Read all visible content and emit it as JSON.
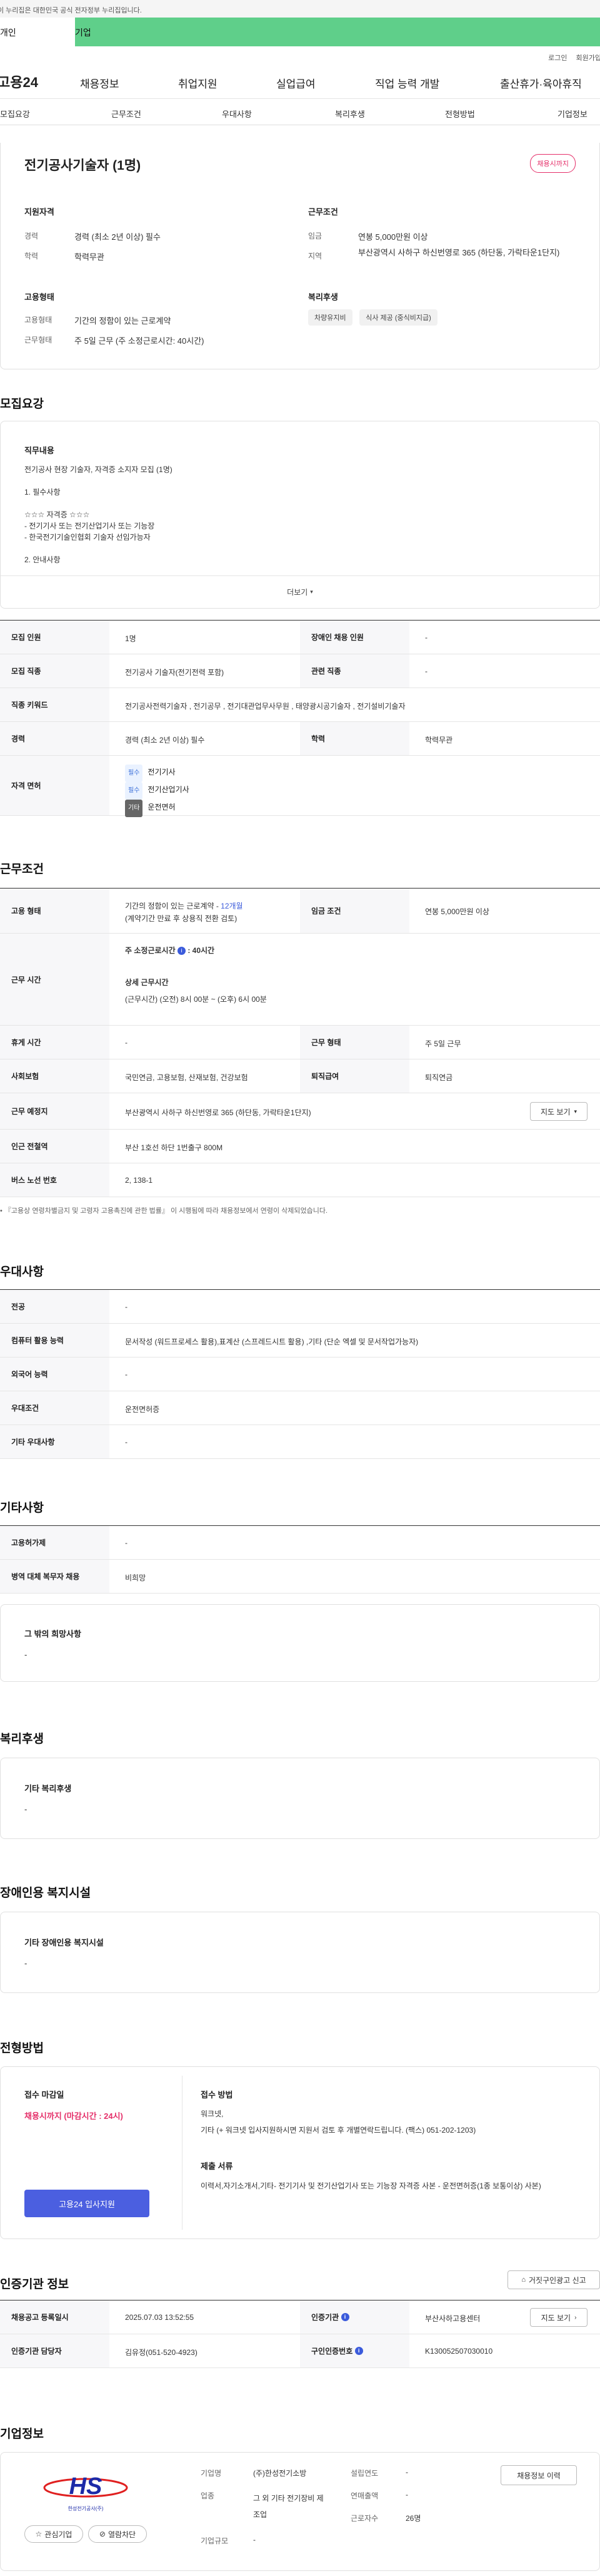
{
  "gov_banner": "이 누리집은 대한민국 공식 전자정부 누리집입니다.",
  "tabs": {
    "personal": "개인",
    "business": "기업"
  },
  "util": {
    "login": "로그인",
    "join": "회원가입"
  },
  "gnb": {
    "logo": "고용24",
    "items": [
      "채용정보",
      "취업지원",
      "실업급여",
      "직업 능력 개발",
      "출산휴가·육아휴직"
    ]
  },
  "subnav": [
    "모집요강",
    "근무조건",
    "우대사항",
    "복리후생",
    "전형방법",
    "기업정보"
  ],
  "summary": {
    "title": "전기공사기술자 (1명)",
    "badge": "채용시까지",
    "qual_title": "지원자격",
    "qual": [
      {
        "k": "경력",
        "v": "경력 (최소 2년 이상) 필수"
      },
      {
        "k": "학력",
        "v": "학력무관"
      }
    ],
    "cond_title": "근무조건",
    "cond": [
      {
        "k": "임금",
        "v": "연봉 5,000만원 이상"
      },
      {
        "k": "지역",
        "v": "부산광역시 사하구 하신번영로 365 (하단동, 가락타운1단지)"
      }
    ],
    "emp_title": "고용형태",
    "emp": [
      {
        "k": "고용형태",
        "v": "기간의 정함이 있는 근로계약"
      },
      {
        "k": "근무형태",
        "v": "주 5일 근무 (주 소정근로시간: 40시간)"
      }
    ],
    "welfare_title": "복리후생",
    "welfare_chips": [
      "차량유지비",
      "식사 제공 (중식비지급)"
    ]
  },
  "recruit": {
    "title": "모집요강",
    "duty_title": "직무내용",
    "duty_lines": [
      "전기공사 현장 기술자, 자격증 소지자 모집 (1명)",
      "",
      "1. 필수사항",
      "",
      "☆☆☆ 자격증 ☆☆☆",
      "- 전기기사 또는 전기산업기사 또는 기능장",
      "- 한국전기기술인협회 기술자 선임가능자",
      "",
      "2. 안내사항"
    ],
    "more": "더보기",
    "rows": [
      {
        "k1": "모집 인원",
        "v1": "1명",
        "k2": "장애인 채용 인원",
        "v2": "-"
      },
      {
        "k1": "모집 직종",
        "v1": "전기공사 기술자(전기전력 포함)",
        "k2": "관련 직종",
        "v2": "-"
      },
      {
        "k1": "직종 키워드",
        "v1": "전기공사전력기술자 , 전기공무 , 전기대관업무사무원 , 태양광시공기술자 , 전기설비기술자"
      },
      {
        "k1": "경력",
        "v1": "경력 (최소 2년 이상) 필수",
        "k2": "학력",
        "v2": "학력무관"
      }
    ],
    "license_label": "자격 면허",
    "licenses": [
      {
        "tag": "필수",
        "name": "전기기사"
      },
      {
        "tag": "필수",
        "name": "전기산업기사"
      },
      {
        "tag": "기타",
        "name": "운전면허"
      }
    ]
  },
  "work": {
    "title": "근무조건",
    "emp_type_label": "고용 형태",
    "emp_type": "기간의 정함이 있는 근로계약 - ",
    "emp_months": "12개월",
    "emp_note": "(계약기간 만료 후 상용직 전환 검토)",
    "wage_label": "임금 조건",
    "wage": "연봉 5,000만원 이상",
    "hours_label": "근무 시간",
    "hours_main": "주 소정근로시간",
    "hours_value": ": 40시간",
    "hours_detail_title": "상세 근무시간",
    "hours_detail": "(근무시간) (오전) 8시 00분 ~ (오후) 6시 00분",
    "rest_label": "휴게 시간",
    "rest": "-",
    "form_label": "근무 형태",
    "form": "주 5일 근무",
    "insurance_label": "사회보험",
    "insurance": "국민연금, 고용보험, 산재보험, 건강보험",
    "retire_label": "퇴직급여",
    "retire": "퇴직연금",
    "place_label": "근무 예정지",
    "place": "부산광역시 사하구 하신번영로 365 (하단동, 가락타운1단지)",
    "map_btn": "지도 보기",
    "subway_label": "인근 전철역",
    "subway": "부산 1호선 하단 1번출구 800M",
    "bus_label": "버스 노선 번호",
    "bus": "2, 138-1",
    "notice": "『고용상 연령차별금지 및 고령자 고용촉진에 관한 법률』 이 시행됨에 따라 채용정보에서 연령이 삭제되었습니다."
  },
  "prefer": {
    "title": "우대사항",
    "rows": [
      {
        "k": "전공",
        "v": "-"
      },
      {
        "k": "컴퓨터 활용 능력",
        "v": "문서작성 (워드프로세스 활용),표계산 (스프레드시트 활용) ,기타 (단순 엑셀 및 문서작업가능자)"
      },
      {
        "k": "외국어 능력",
        "v": "-"
      },
      {
        "k": "우대조건",
        "v": "운전면허증"
      },
      {
        "k": "기타 우대사항",
        "v": "-"
      }
    ]
  },
  "etc": {
    "title": "기타사항",
    "rows": [
      {
        "k": "고용허가제",
        "v": "-"
      },
      {
        "k": "병역 대체 복무자 채용",
        "v": "비희망"
      }
    ],
    "wish_title": "그 밖의 희망사항",
    "wish": "-"
  },
  "benefit": {
    "title": "복리후생",
    "box_title": "기타 복리후생",
    "box_val": "-"
  },
  "disabled": {
    "title": "장애인용 복지시설",
    "box_title": "기타 장애인용 복지시설",
    "box_val": "-"
  },
  "process": {
    "title": "전형방법",
    "deadline_title": "접수 마감일",
    "deadline": "채용시까지 (마감시간 : 24시)",
    "apply_btn": "고용24 입사지원",
    "method_title": "접수 방법",
    "method_lines": [
      "워크넷,",
      "기타 (+ 워크넷 입사지원하시면 지원서 검토 후 개별연락드립니다.  (팩스) 051-202-1203)"
    ],
    "docs_title": "제출 서류",
    "docs": "이력서,자기소개서,기타- 전기기사 및 전기산업기사 또는 기능장 자격증 사본 - 운전면허증(1종 보통이상) 사본)"
  },
  "agency": {
    "title": "인증기관 정보",
    "report_btn": "거짓구인광고 신고",
    "rows": [
      {
        "k1": "채용공고 등록일시",
        "v1": "2025.07.03 13:52:55",
        "k2": "인증기관",
        "v2": "부산사하고용센터"
      },
      {
        "k1": "인증기관 담당자",
        "v1": "김유정(051-520-4923)",
        "k2": "구인인증번호",
        "v2": "K130052507030010"
      }
    ],
    "map_btn": "지도 보기"
  },
  "company": {
    "title": "기업정보",
    "logo_text": "HS",
    "logo_sub": "한성전기공사(주)",
    "fav_btn": "관심기업",
    "block_btn": "열람차단",
    "rows": [
      {
        "k": "기업명",
        "v": "(주)한성전기소방"
      },
      {
        "k": "업종",
        "v": "그 외 기타 전기장비 제조업"
      },
      {
        "k": "기업규모",
        "v": "-"
      }
    ],
    "rows2": [
      {
        "k": "설립연도",
        "v": "-"
      },
      {
        "k": "연매출액",
        "v": "-"
      },
      {
        "k": "근로자수",
        "v": "26명"
      }
    ],
    "history_btn": "채용정보 이력"
  },
  "colors": {
    "accent": "#3b5bdb",
    "business_tab": "#5fcf8a",
    "badge": "#e5306a",
    "deadline": "#e5306a"
  }
}
